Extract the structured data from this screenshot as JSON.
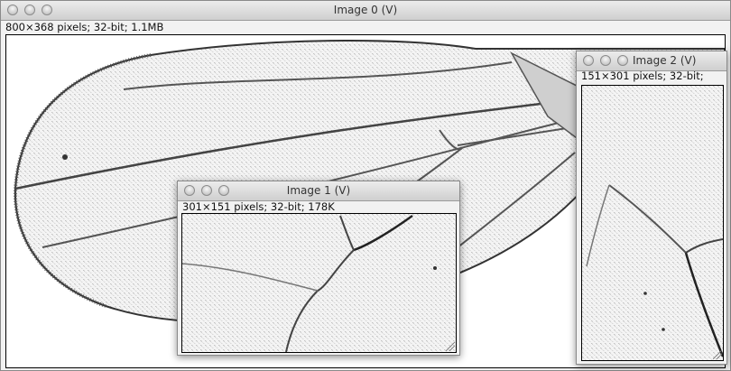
{
  "windows": {
    "main": {
      "title": "Image 0 (V)",
      "info": "800×368 pixels; 32-bit; 1.1MB"
    },
    "crop1": {
      "title": "Image 1 (V)",
      "info": "301×151 pixels; 32-bit; 178K"
    },
    "crop2": {
      "title": "Image 2 (V)",
      "info": "151×301 pixels; 32-bit;"
    }
  },
  "icons": {
    "close": "close-button-icon",
    "minimize": "minimize-button-icon",
    "zoom": "zoom-button-icon",
    "resize": "resize-grip-icon"
  }
}
